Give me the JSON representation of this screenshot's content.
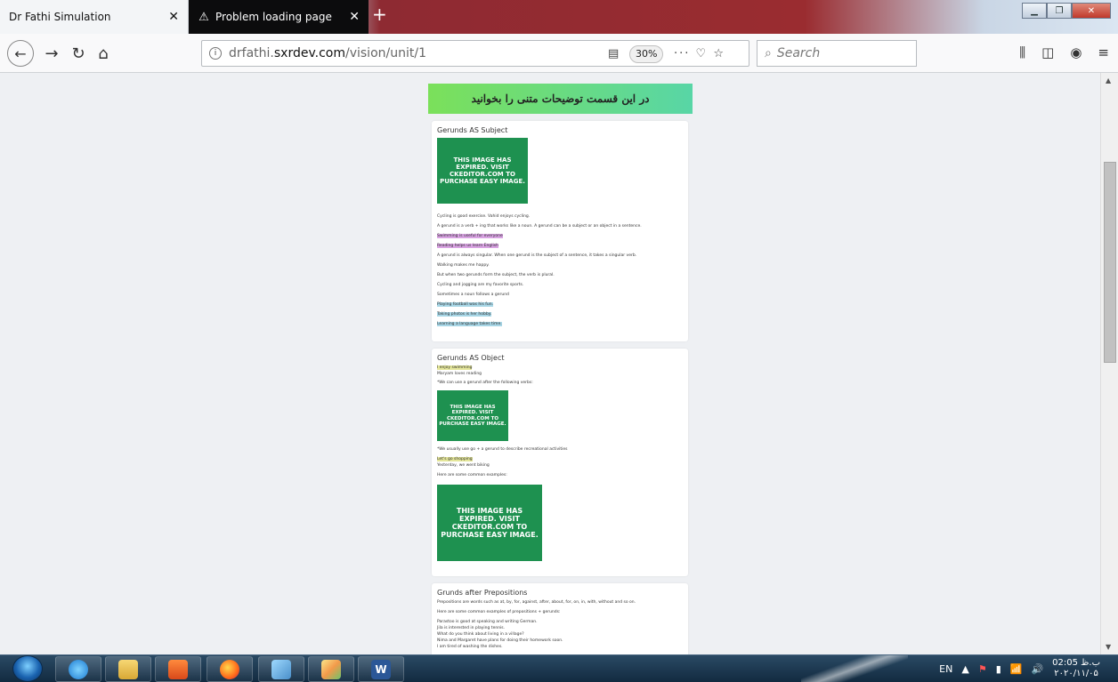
{
  "browser": {
    "tabs": [
      {
        "label": "Dr Fathi Simulation",
        "close": "✕"
      },
      {
        "label": "Problem loading page",
        "close": "✕"
      }
    ],
    "new_tab": "+",
    "url_prefix": "drfathi.",
    "url_domain": "sxrdev.com",
    "url_path": "/vision/unit/1",
    "zoom": "30%",
    "search_placeholder": "Search"
  },
  "page": {
    "banner": "در این قسمت توضیحات متنی را بخوانید",
    "expired_text": "THIS IMAGE HAS EXPIRED. VISIT CKEDITOR.COM TO PURCHASE EASY IMAGE.",
    "sections": [
      {
        "title": "Gerunds  AS Subject",
        "lines": [
          "Cycling is good exercise. Vahid enjoys cycling.",
          "A gerund is a verb + ing that works like a noun. A gerund can be a subject or an object in a sentence.",
          "Swimming is useful for everyone",
          "Reading helps us learn English",
          "A gerund is always singular. When one gerund is the subject of a sentence, it takes a singular verb.",
          "Walking makes me happy.",
          "But when two gerunds form the subject, the verb is plural.",
          "Cycling and jogging are my favorite sports.",
          "Sometimes a noun follows a gerund",
          "Playing football was his fun.",
          "Taking photos is her hobby.",
          "Learning a language takes time."
        ]
      },
      {
        "title": "Gerunds  AS Object",
        "lines_a": [
          "I enjoy swimming",
          "Maryam loves reading"
        ],
        "line_b": "*We can use a gerund after the following verbs:",
        "line_c": "*We usually use go + a gerund to describe recreational activities",
        "lines_d": [
          "Let's go shopping",
          "Yesterday, we went biking"
        ],
        "line_e": "Here are some common examples:"
      },
      {
        "title": "Grunds after Prepositions",
        "line_a": "Prepositions are words such as at, by, for, against, after, about, for, on, in, with, without and so on.",
        "line_b": "Here are some common examples of prepositions + gerunds:",
        "lines_c": [
          "Parastoo is good at speaking and writing German.",
          "Jila is interested in playing tennis.",
          "What do you think about living in a village?",
          "Nima and Margaret have plans for doing their homework soon.",
          "I am tired of washing the dishes."
        ]
      }
    ]
  },
  "taskbar": {
    "lang": "EN",
    "time": "02:05 ب.ظ",
    "date": "۲۰۲۰/۱۱/۰۵",
    "word_label": "W"
  }
}
